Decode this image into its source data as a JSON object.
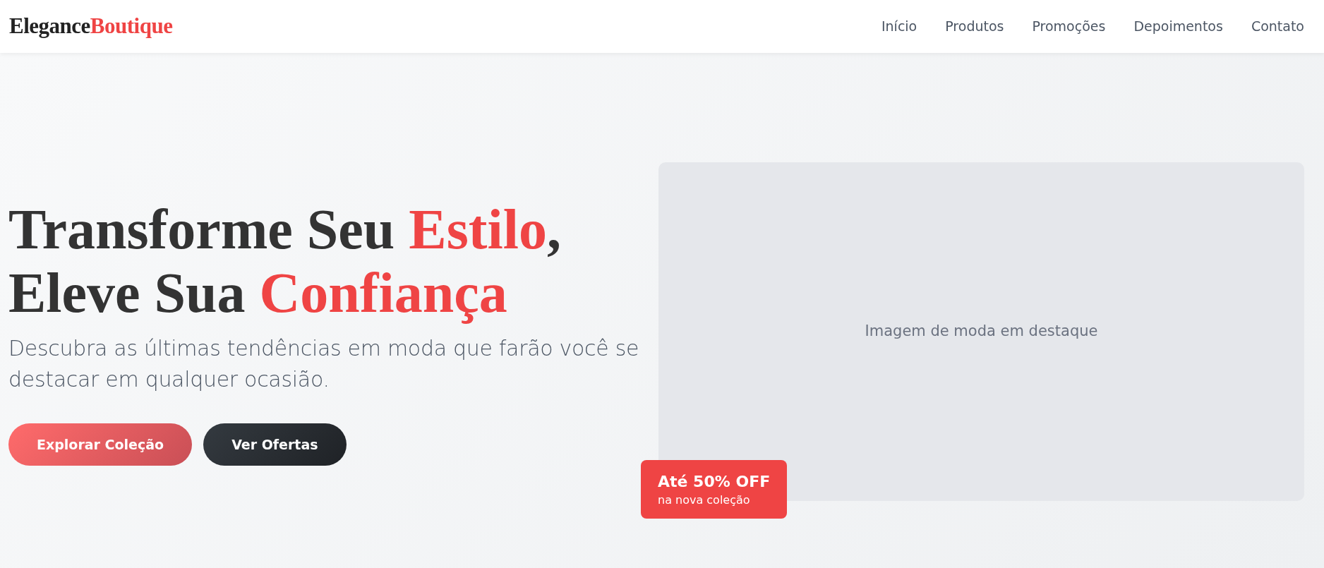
{
  "brand": {
    "first": "Elegance",
    "second": "Boutique"
  },
  "nav": [
    {
      "label": "Início"
    },
    {
      "label": "Produtos"
    },
    {
      "label": "Promoções"
    },
    {
      "label": "Depoimentos"
    },
    {
      "label": "Contato"
    }
  ],
  "hero": {
    "headline": [
      [
        {
          "text": "Transforme Seu ",
          "accent": false
        },
        {
          "text": "Estilo",
          "accent": true
        },
        {
          "text": ",",
          "accent": false
        }
      ],
      [
        {
          "text": "Eleve Sua ",
          "accent": false
        },
        {
          "text": "Confiança",
          "accent": true
        }
      ]
    ],
    "subtitle": "Descubra as últimas tendências em moda que farão você se destacar em qualquer ocasião.",
    "buttons": [
      {
        "label": "Explorar Coleção",
        "kind": "primary"
      },
      {
        "label": "Ver Ofertas",
        "kind": "dark"
      }
    ],
    "image": {
      "caption": "Imagem de moda em destaque"
    },
    "promo": {
      "title": "Até 50% OFF",
      "subtitle": "na nova coleção"
    }
  }
}
